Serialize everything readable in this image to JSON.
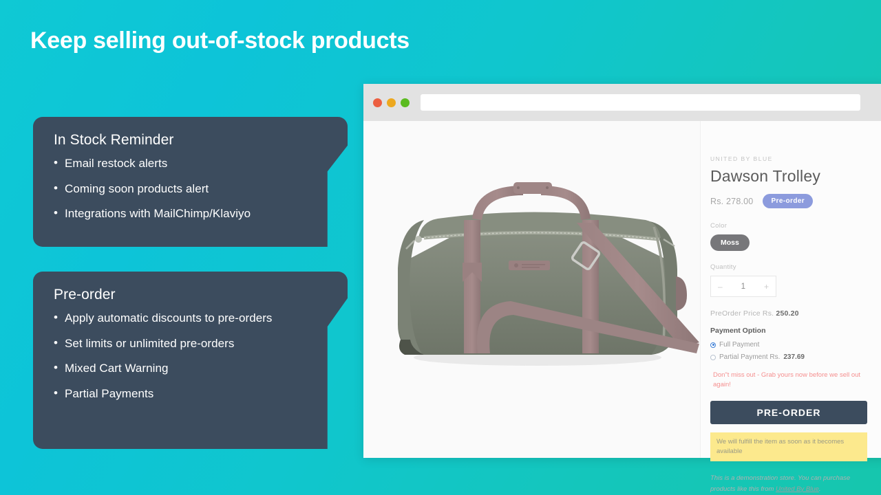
{
  "slide": {
    "title": "Keep selling out-of-stock products",
    "background_top": "#0dc4d8",
    "background_bottom": "#16c6ad",
    "card_color": "#3c4c5e"
  },
  "cards": [
    {
      "title": "In Stock Reminder",
      "bullet": "•",
      "items": [
        "Email restock alerts",
        "Coming soon products alert",
        "Integrations with MailChimp/Klaviyo"
      ]
    },
    {
      "title": "Pre-order",
      "bullet": "•",
      "items": [
        "Apply automatic discounts to pre-orders",
        "Set limits or unlimited pre-orders",
        "Mixed Cart Warning",
        "Partial Payments"
      ]
    }
  ],
  "browser": {
    "url_value": "",
    "url_placeholder": "",
    "traffic_lights": [
      "close-red",
      "minimize-yellow",
      "maximize-green"
    ]
  },
  "product": {
    "vendor": "UNITED BY BLUE",
    "title": "Dawson Trolley",
    "price": "Rs. 278.00",
    "badge": "Pre-order",
    "badge_color": "#8c9bdd",
    "color_label": "Color",
    "color_value": "Moss",
    "color_swatch_hex": "#77777a",
    "quantity_label": "Quantity",
    "quantity_value": "1",
    "quantity_minus": "–",
    "quantity_plus": "+",
    "preorder_price_prefix": "PreOrder Price Rs. ",
    "preorder_price_value": "250.20",
    "payment_option_label": "Payment Option",
    "payment_options": [
      {
        "label": "Full Payment",
        "amount": "",
        "selected": true
      },
      {
        "label": "Partial Payment Rs. ",
        "amount": "237.69",
        "selected": false
      }
    ],
    "urgency_text": "Don\"t miss out - Grab yours now before we sell out again!",
    "urgency_color": "#f58f8f",
    "cta_label": "PRE-ORDER",
    "cta_color": "#3c4c5e",
    "fulfillment_notice": "We will fulfill the item as soon as it becomes available",
    "fulfillment_notice_color": "#fce98d",
    "demo_note_prefix": "This is a demonstration store. You can purchase products like this from ",
    "demo_note_link": "United By Blue",
    "demo_note_suffix": ".",
    "image_alt": "moss green canvas duffel bag with brown leather straps"
  }
}
